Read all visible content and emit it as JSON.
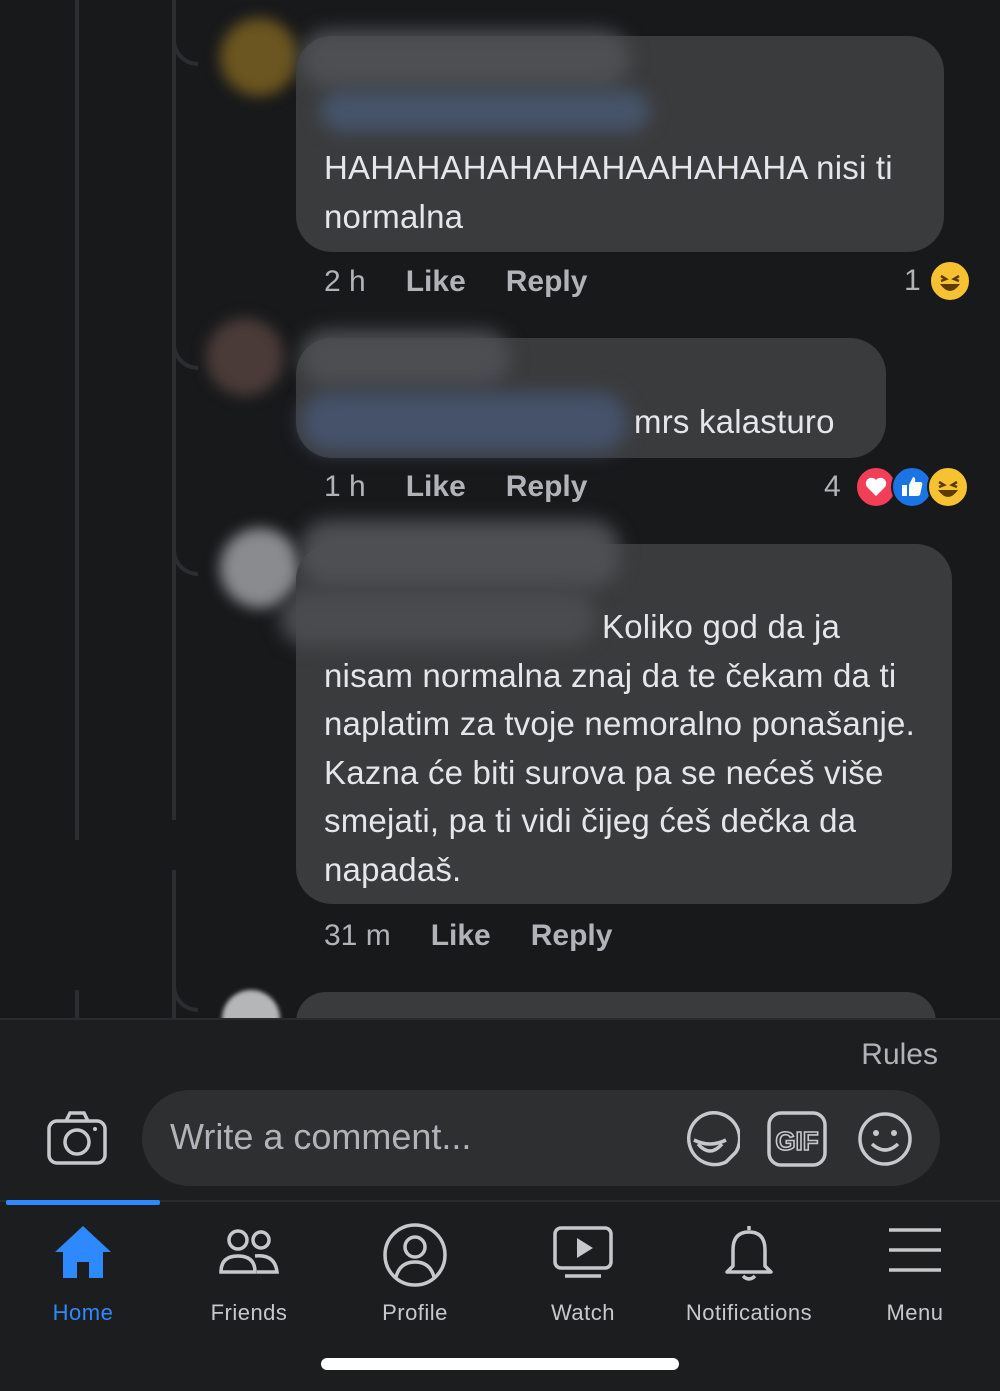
{
  "comments": [
    {
      "text": "HAHAHAHAHAHAHAAHAHAHA nisi ti normalna",
      "time": "2 h",
      "like": "Like",
      "reply": "Reply",
      "reaction_count": "1",
      "reactions": [
        "haha"
      ]
    },
    {
      "text": "mrs kalasturo",
      "time": "1 h",
      "like": "Like",
      "reply": "Reply",
      "reaction_count": "4",
      "reactions": [
        "love",
        "like",
        "haha"
      ]
    },
    {
      "text": "Koliko god da ja nisam normalna znaj da te čekam da ti naplatim za tvoje nemoralno ponašanje. Kazna će biti surova pa se nećeš više smejati, pa ti vidi čijeg ćeš dečka da napadaš.",
      "time": "31 m",
      "like": "Like",
      "reply": "Reply"
    }
  ],
  "composer": {
    "rules": "Rules",
    "placeholder": "Write a comment...",
    "icons": [
      "camera-icon",
      "sticker-icon",
      "gif-icon",
      "emoji-icon"
    ]
  },
  "tabs": [
    {
      "label": "Home",
      "icon": "home-icon",
      "active": true
    },
    {
      "label": "Friends",
      "icon": "friends-icon"
    },
    {
      "label": "Profile",
      "icon": "profile-icon"
    },
    {
      "label": "Watch",
      "icon": "watch-icon"
    },
    {
      "label": "Notifications",
      "icon": "bell-icon"
    },
    {
      "label": "Menu",
      "icon": "menu-icon"
    }
  ],
  "colors": {
    "background": "#18191b",
    "bubble": "#3a3b3c",
    "accent": "#2e89ff",
    "secondary_text": "#b0b3b8"
  }
}
